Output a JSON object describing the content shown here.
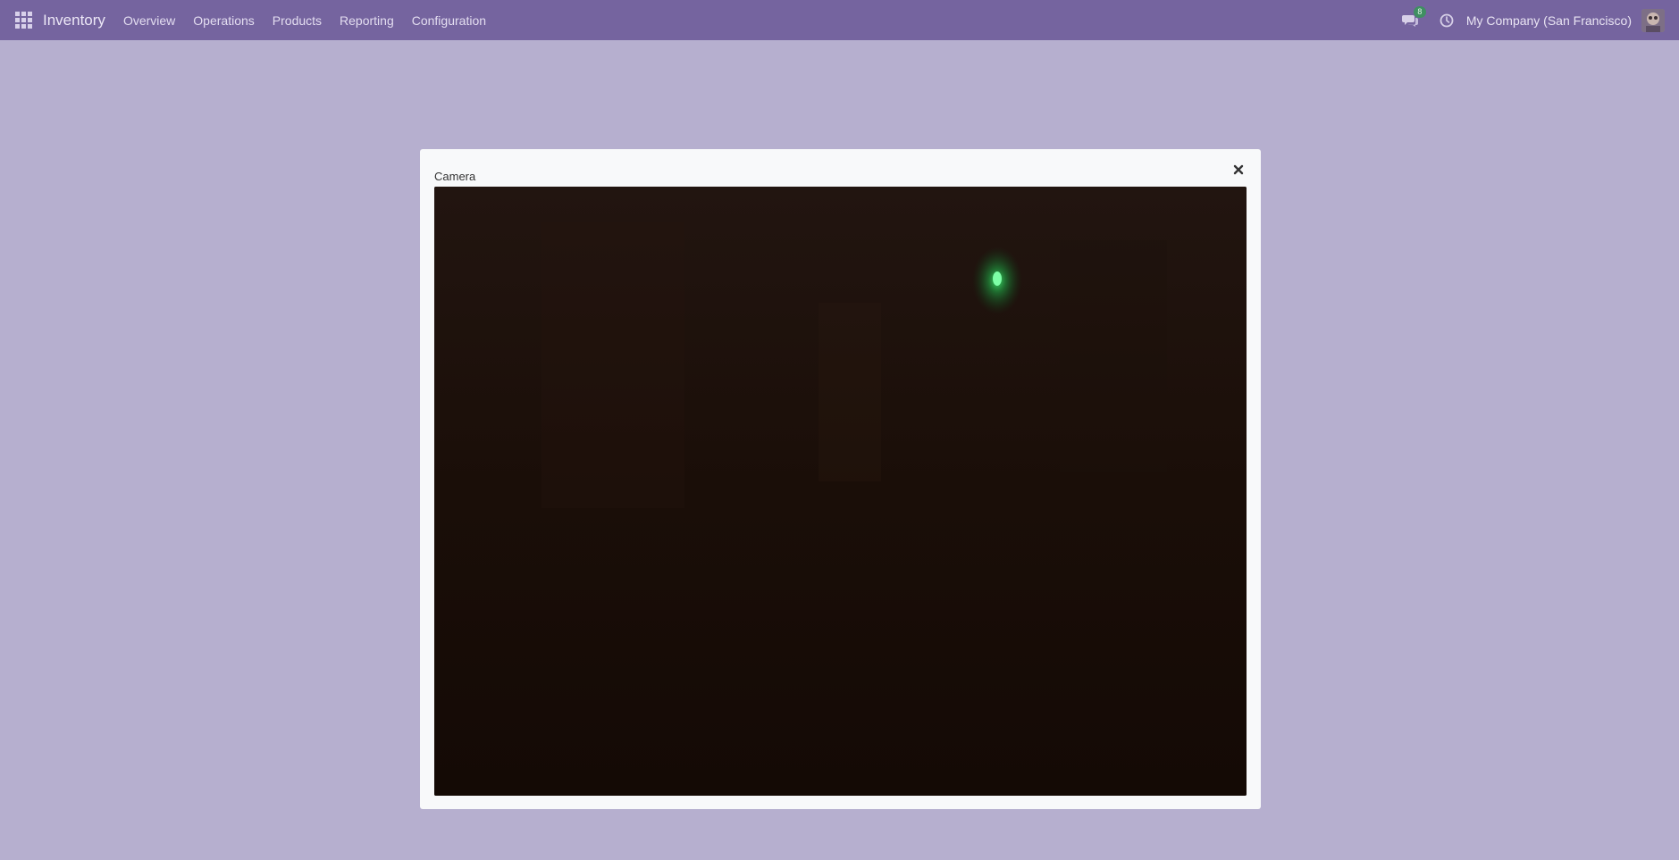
{
  "navbar": {
    "app_name": "Inventory",
    "menu": [
      "Overview",
      "Operations",
      "Products",
      "Reporting",
      "Configuration"
    ],
    "chat_count": "8",
    "company": "My Company (San Francisco)",
    "bg_color": "#75649f"
  },
  "dialog": {
    "title": "Camera"
  }
}
